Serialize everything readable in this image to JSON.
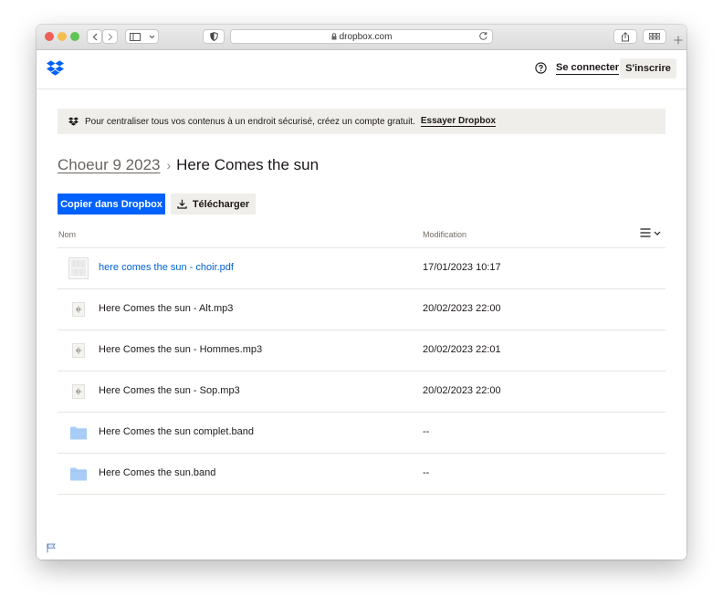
{
  "browser": {
    "url": "dropbox.com"
  },
  "header": {
    "signin_label": "Se connecter",
    "signup_label": "S'inscrire"
  },
  "banner": {
    "text": "Pour centraliser tous vos contenus à un endroit sécurisé, créez un compte gratuit.",
    "cta": "Essayer Dropbox"
  },
  "breadcrumb": {
    "parent": "Choeur 9 2023",
    "separator": "›",
    "current": "Here Comes the sun"
  },
  "actions": {
    "copy_label": "Copier dans Dropbox",
    "download_label": "Télécharger"
  },
  "table": {
    "col_name": "Nom",
    "col_modified": "Modification",
    "rows": [
      {
        "name": "here comes the sun - choir.pdf",
        "modified": "17/01/2023 10:17",
        "icon": "pdf-thumbnail-icon"
      },
      {
        "name": "Here Comes the sun - Alt.mp3",
        "modified": "20/02/2023 22:00",
        "icon": "audio-file-icon"
      },
      {
        "name": "Here Comes the sun - Hommes.mp3",
        "modified": "20/02/2023 22:01",
        "icon": "audio-file-icon"
      },
      {
        "name": "Here Comes the sun - Sop.mp3",
        "modified": "20/02/2023 22:00",
        "icon": "audio-file-icon"
      },
      {
        "name": "Here Comes the sun complet.band",
        "modified": "--",
        "icon": "folder-icon"
      },
      {
        "name": "Here Comes the sun.band",
        "modified": "--",
        "icon": "folder-icon"
      }
    ]
  },
  "colors": {
    "accent": "#0061fe",
    "link": "#0061d5",
    "folder": "#a9cdf6",
    "banner_bg": "#f0eeea"
  }
}
